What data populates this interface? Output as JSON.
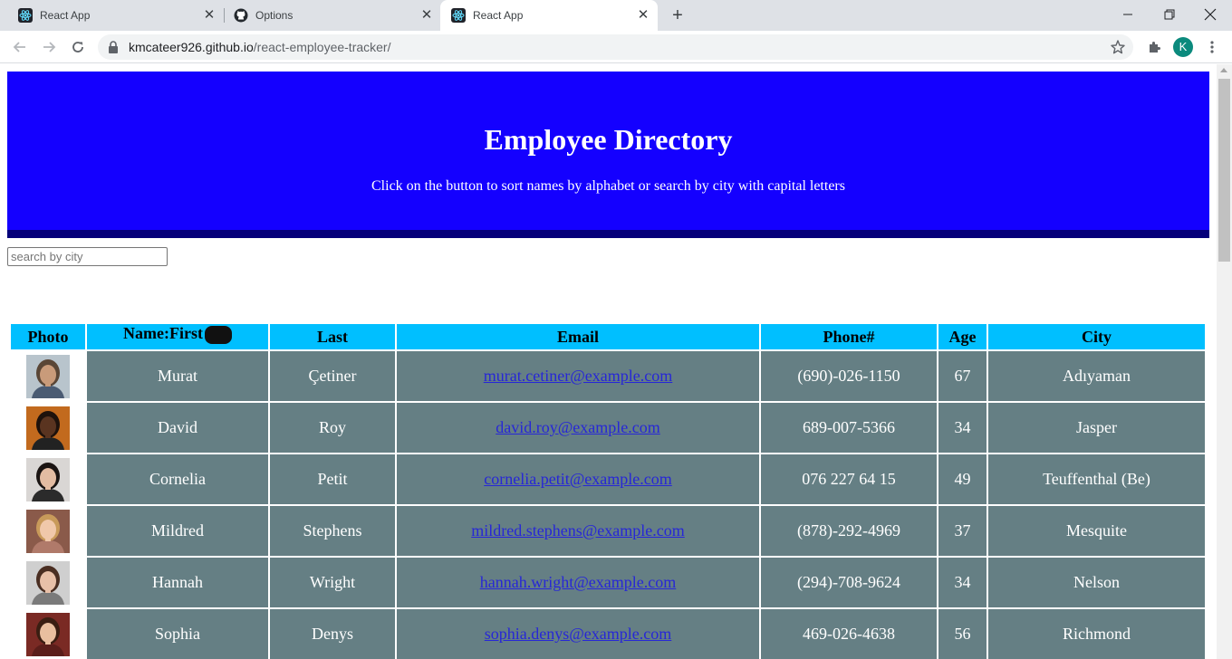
{
  "browser": {
    "tabs": [
      {
        "title": "React App",
        "icon": "react-icon"
      },
      {
        "title": "Options",
        "icon": "github-icon"
      },
      {
        "title": "React App",
        "icon": "react-icon",
        "active": true
      }
    ],
    "url_host": "kmcateer926.github.io",
    "url_path": "/react-employee-tracker/",
    "profile_initial": "K",
    "profile_color": "#0b8a7d"
  },
  "page": {
    "title": "Employee Directory",
    "subtitle": "Click on the button to sort names by alphabet or search by city with capital letters",
    "search_placeholder": "search by city",
    "header_color": "#1400ff",
    "table_header_color": "#00bfff",
    "row_color": "#657f84"
  },
  "table": {
    "headers": {
      "photo": "Photo",
      "first": "Name:First",
      "last": "Last",
      "email": "Email",
      "phone": "Phone#",
      "age": "Age",
      "city": "City"
    },
    "rows": [
      {
        "first": "Murat",
        "last": "Çetiner",
        "email": "murat.cetiner@example.com",
        "phone": "(690)-026-1150",
        "age": "67",
        "city": "Adıyaman",
        "skin": "#c99b7a",
        "hair": "#5a4636",
        "bg": "#b8c4cc",
        "shirt": "#4a5b73"
      },
      {
        "first": "David",
        "last": "Roy",
        "email": "david.roy@example.com",
        "phone": "689-007-5366",
        "age": "34",
        "city": "Jasper",
        "skin": "#5a3420",
        "hair": "#1e120c",
        "bg": "#c26a1e",
        "shirt": "#222"
      },
      {
        "first": "Cornelia",
        "last": "Petit",
        "email": "cornelia.petit@example.com",
        "phone": "076 227 64 15",
        "age": "49",
        "city": "Teuffenthal (Be)",
        "skin": "#e3bca2",
        "hair": "#1a1412",
        "bg": "#d9d6d4",
        "shirt": "#2b2b2b"
      },
      {
        "first": "Mildred",
        "last": "Stephens",
        "email": "mildred.stephens@example.com",
        "phone": "(878)-292-4969",
        "age": "37",
        "city": "Mesquite",
        "skin": "#f0c8aa",
        "hair": "#c89a5a",
        "bg": "#8a5a4a",
        "shirt": "#b07a6a"
      },
      {
        "first": "Hannah",
        "last": "Wright",
        "email": "hannah.wright@example.com",
        "phone": "(294)-708-9624",
        "age": "34",
        "city": "Nelson",
        "skin": "#e8c0a8",
        "hair": "#4a2e22",
        "bg": "#cfcfcf",
        "shirt": "#7a7a7a"
      },
      {
        "first": "Sophia",
        "last": "Denys",
        "email": "sophia.denys@example.com",
        "phone": "469-026-4638",
        "age": "56",
        "city": "Richmond",
        "skin": "#e9bf9f",
        "hair": "#3a1e12",
        "bg": "#7a2a24",
        "shirt": "#5a1e1a"
      }
    ]
  }
}
